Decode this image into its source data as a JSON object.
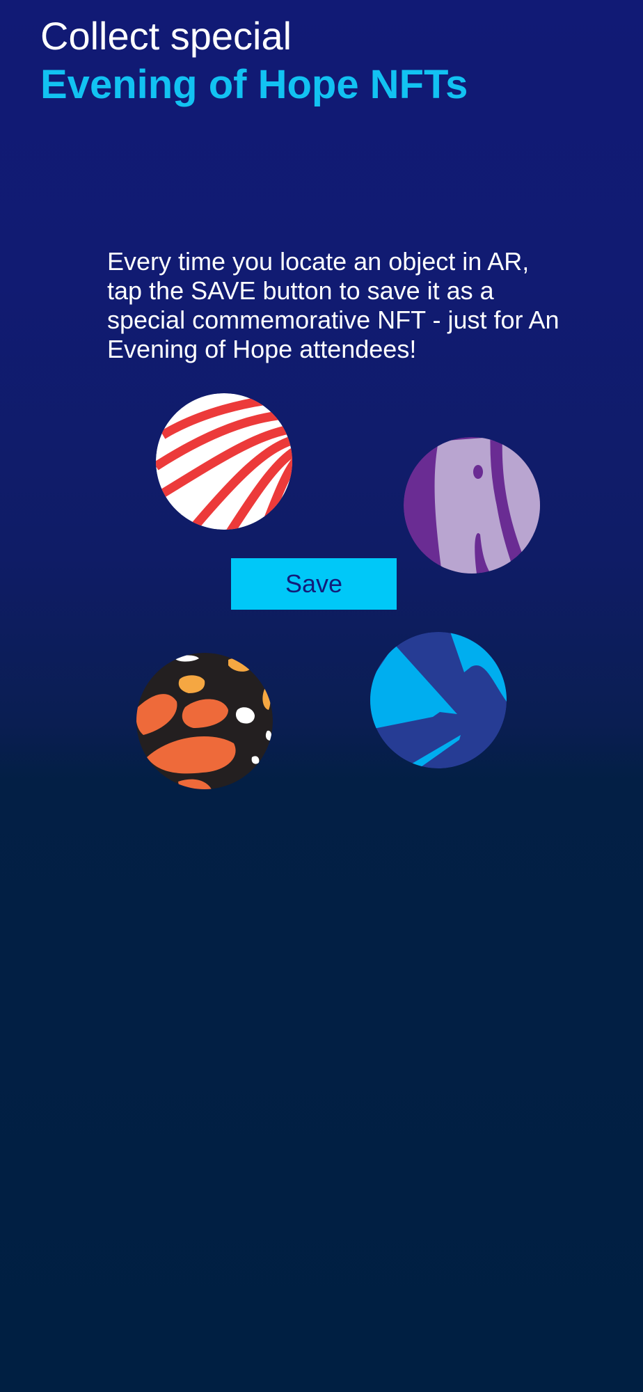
{
  "header": {
    "title_line1": "Collect special",
    "title_line2": "Evening of Hope NFTs"
  },
  "description": "Every time you locate an object in AR, tap the SAVE button to save it as a special commemorative NFT - just for An Evening of Hope attendees!",
  "save_button_label": "Save",
  "nfts": [
    {
      "name": "red-white-stripes-nft",
      "icon": "red-white-stripes"
    },
    {
      "name": "purple-lavender-nft",
      "icon": "purple-abstract"
    },
    {
      "name": "monarch-pattern-nft",
      "icon": "monarch-butterfly-pattern"
    },
    {
      "name": "blue-geometric-nft",
      "icon": "blue-geometric"
    }
  ],
  "colors": {
    "background_top": "#111a75",
    "background_bottom": "#001f42",
    "accent": "#12c2f2",
    "button": "#00c8f8",
    "button_text": "#121d7a"
  }
}
